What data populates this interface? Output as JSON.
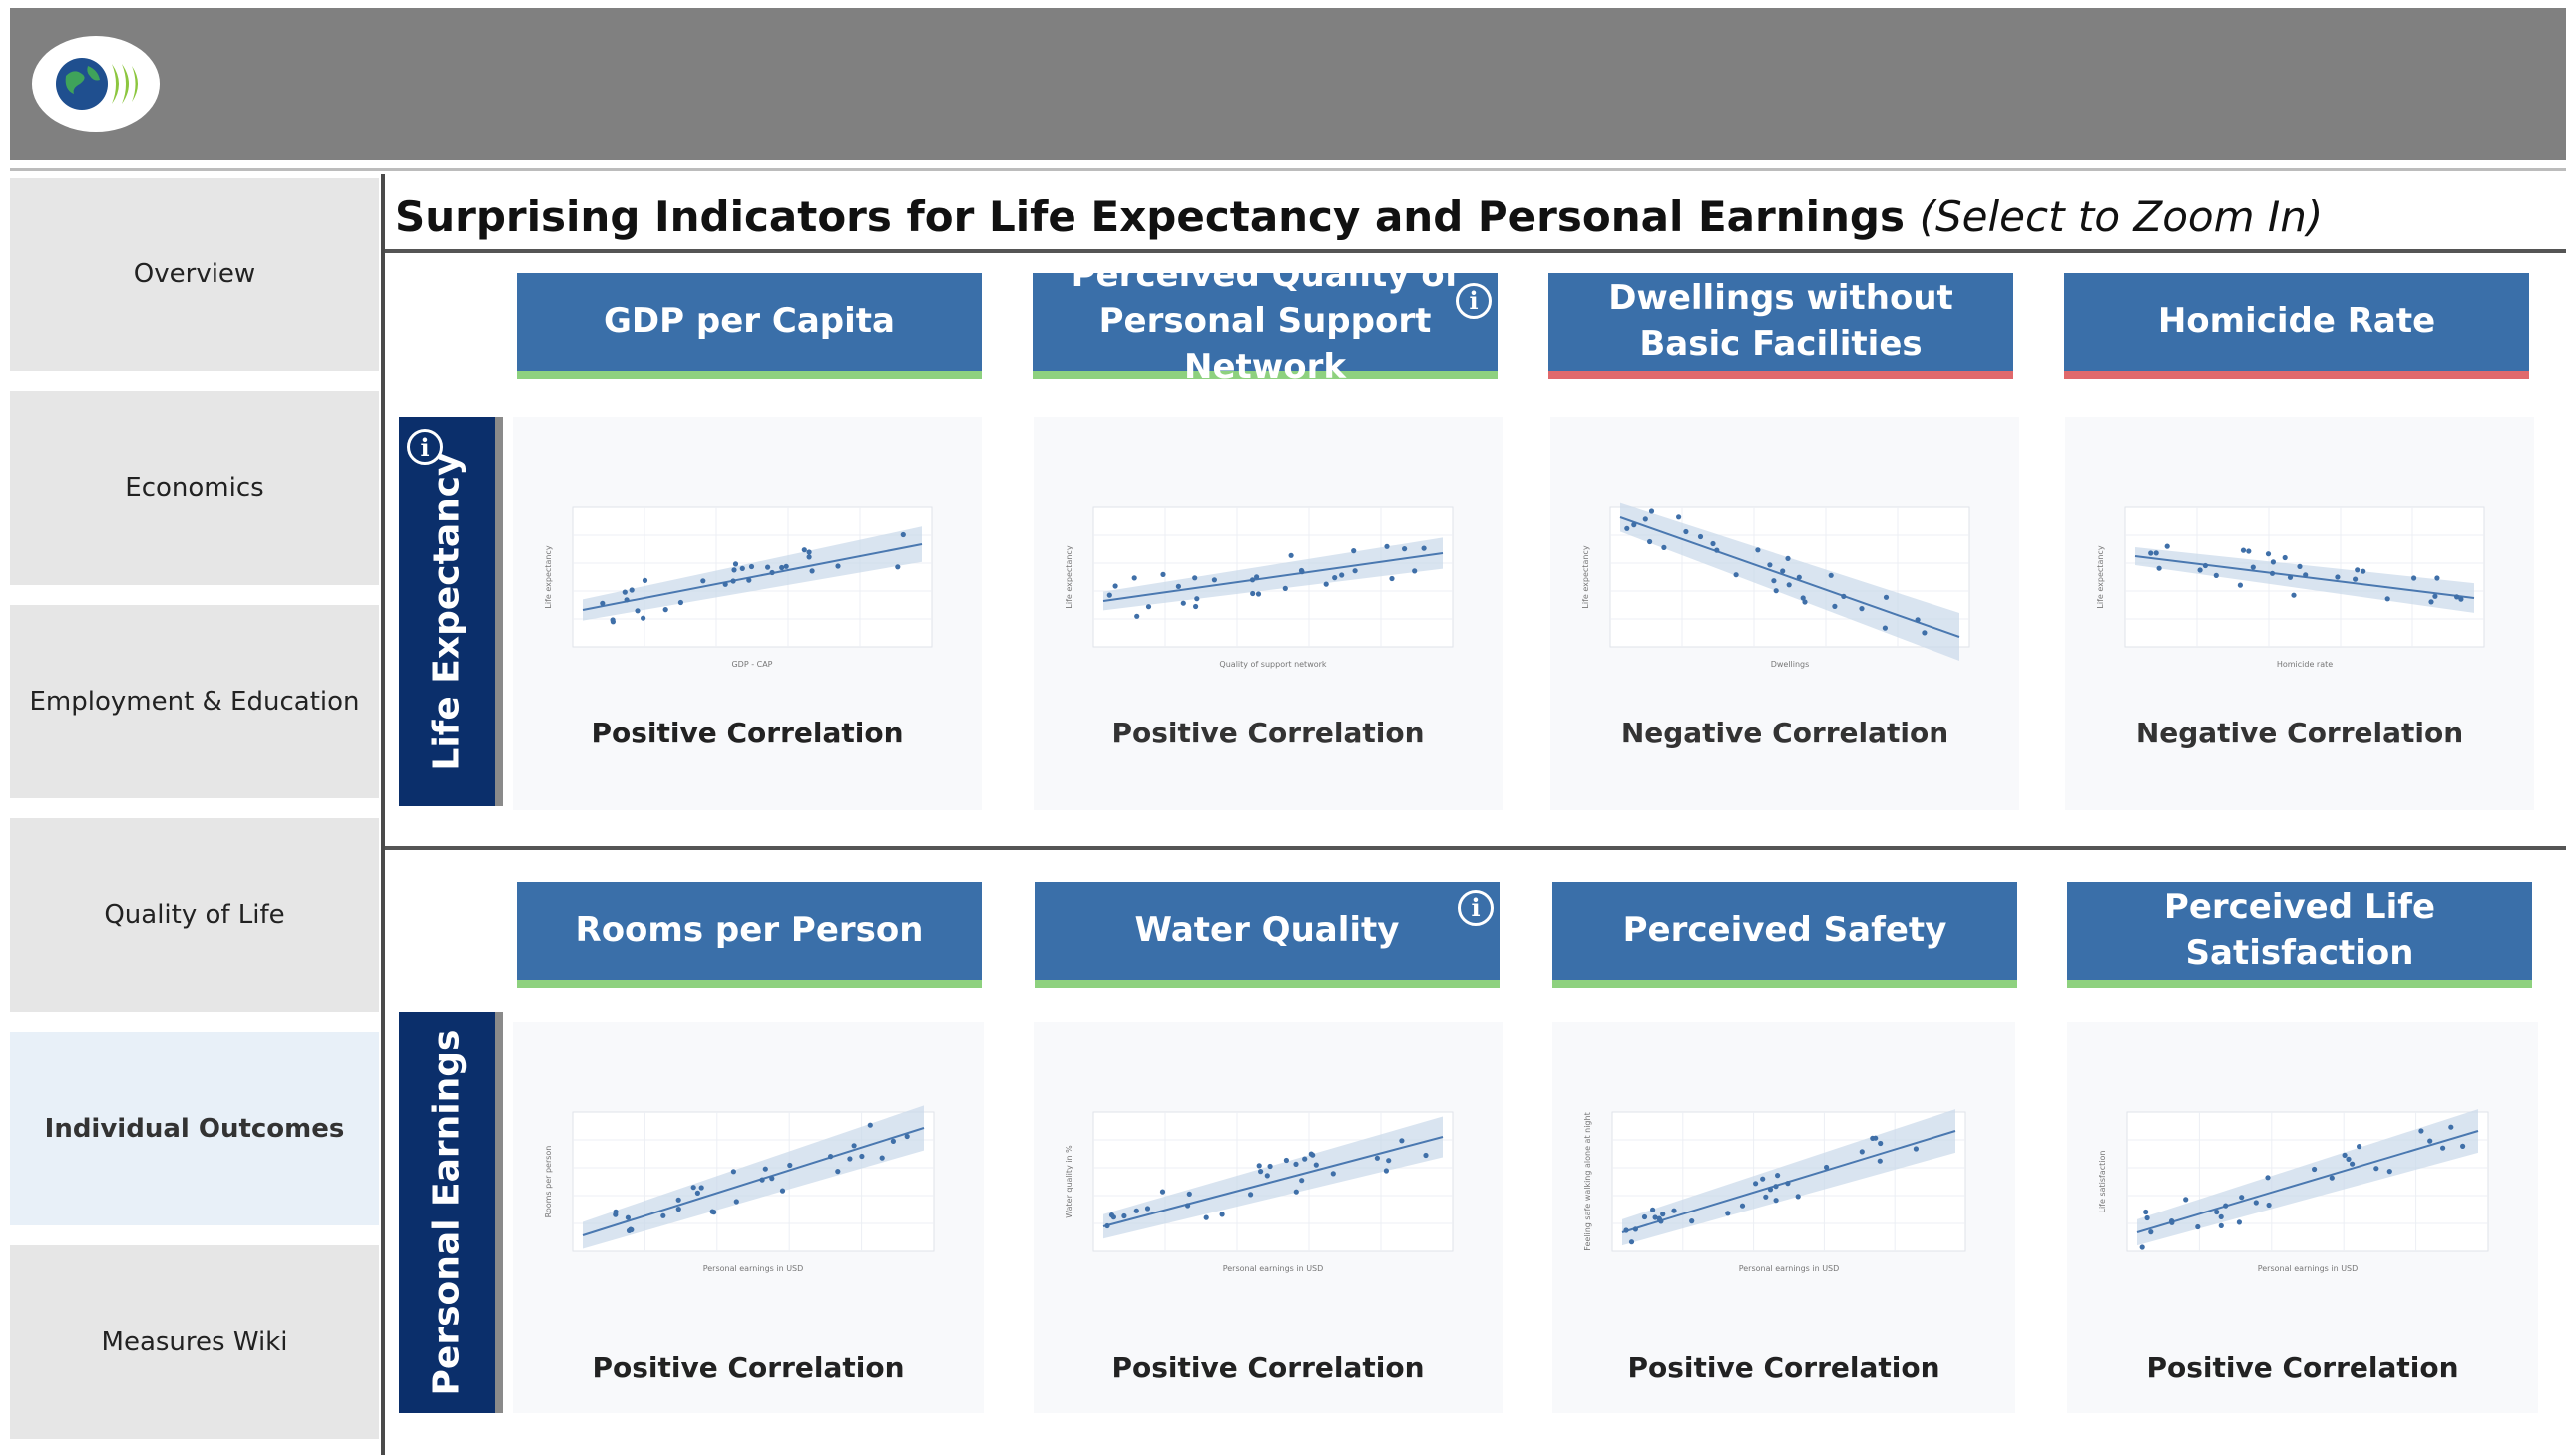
{
  "page": {
    "title": "Surprising Indicators for Life Expectancy and Personal Earnings",
    "title_hint": "(Select to Zoom In)"
  },
  "colors": {
    "header_blue": "#3a6fa9",
    "row_label_navy": "#0b2f6b",
    "positive_bar": "#8ed17f",
    "negative_bar": "#e0696c",
    "active_nav_bg": "#e8f0f8"
  },
  "sidebar": {
    "items": [
      {
        "label": "Overview",
        "active": false
      },
      {
        "label": "Economics",
        "active": false
      },
      {
        "label": "Employment & Education",
        "active": false
      },
      {
        "label": "Quality of Life",
        "active": false
      },
      {
        "label": "Individual Outcomes",
        "active": true
      },
      {
        "label": "Measures Wiki",
        "active": false
      }
    ]
  },
  "rows": [
    {
      "label": "Life Expectancy",
      "cards": [
        {
          "title": "GDP per Capita",
          "correlation": "Positive Correlation",
          "sign": "positive",
          "xlabel": "GDP - CAP",
          "ylabel": "Life expectancy",
          "slope": 0.55
        },
        {
          "title": "Perceived Quality of Personal Support Network",
          "correlation": "Positive Correlation",
          "sign": "positive",
          "xlabel": "Quality of support network",
          "ylabel": "Life expectancy",
          "slope": 0.4
        },
        {
          "title": "Dwellings without Basic Facilities",
          "correlation": "Negative Correlation",
          "sign": "negative",
          "xlabel": "Dwellings",
          "ylabel": "Life expectancy",
          "slope": -1.0
        },
        {
          "title": "Homicide Rate",
          "correlation": "Negative Correlation",
          "sign": "negative",
          "xlabel": "Homicide rate",
          "ylabel": "Life expectancy",
          "slope": -0.35
        }
      ]
    },
    {
      "label": "Personal Earnings",
      "cards": [
        {
          "title": "Rooms per Person",
          "correlation": "Positive Correlation",
          "sign": "positive",
          "xlabel": "Personal earnings in USD",
          "ylabel": "Rooms per person",
          "slope": 0.9
        },
        {
          "title": "Water Quality",
          "correlation": "Positive Correlation",
          "sign": "positive",
          "xlabel": "Personal earnings in USD",
          "ylabel": "Water quality in %",
          "slope": 0.75
        },
        {
          "title": "Perceived Safety",
          "correlation": "Positive Correlation",
          "sign": "positive",
          "xlabel": "Personal earnings in USD",
          "ylabel": "Feeling safe walking alone at night",
          "slope": 0.85
        },
        {
          "title": "Perceived Life Satisfaction",
          "correlation": "Positive Correlation",
          "sign": "positive",
          "xlabel": "Personal earnings in USD",
          "ylabel": "Life satisfaction",
          "slope": 0.85
        }
      ]
    }
  ]
}
